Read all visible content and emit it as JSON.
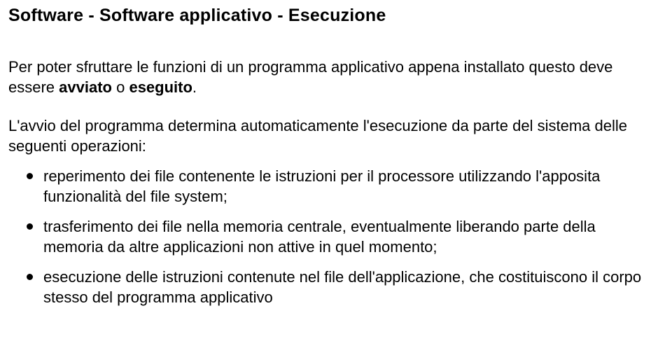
{
  "title": "Software - Software applicativo - Esecuzione",
  "intro": {
    "pre": "Per poter sfruttare le funzioni di un programma applicativo appena installato questo deve essere ",
    "bold1": "avviato",
    "middle": " o ",
    "bold2": "eseguito",
    "post": "."
  },
  "lead": "L'avvio del programma determina automaticamente l'esecuzione da parte del sistema delle seguenti operazioni:",
  "bullets": [
    "reperimento dei file contenente le istruzioni per il processore utilizzando l'apposita funzionalità del file system;",
    "trasferimento dei file nella memoria centrale, eventualmente liberando parte della memoria da altre applicazioni non attive in quel momento;",
    "esecuzione delle istruzioni contenute nel file dell'applicazione, che costituiscono il corpo stesso del programma applicativo"
  ]
}
